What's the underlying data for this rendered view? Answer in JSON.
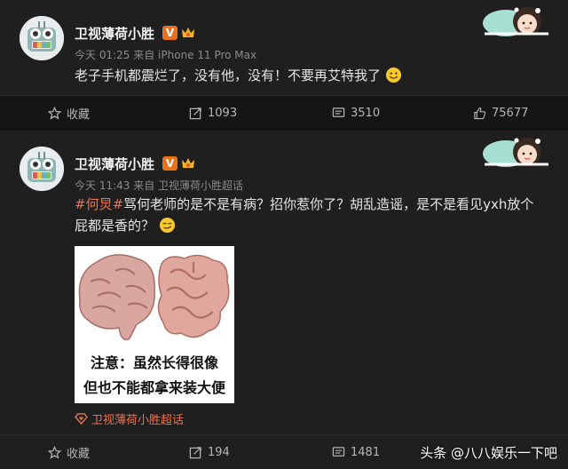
{
  "posts": [
    {
      "username": "卫视薄荷小胜",
      "verified_mark": "V",
      "time": "今天 01:25",
      "source": "来自 iPhone 11 Pro Max",
      "text": "老子手机都震烂了，没有他，没有！不要再艾特我了",
      "actions": {
        "favorite": "收藏",
        "repost": "1093",
        "comment": "3510",
        "like": "75677"
      }
    },
    {
      "username": "卫视薄荷小胜",
      "verified_mark": "V",
      "time": "今天 11:43",
      "source": "来自 卫视薄荷小胜超话",
      "topic": "#何炅#",
      "text": "骂何老师的是不是有病？招你惹你了？胡乱造谣，是不是看见yxh放个屁都是香的？",
      "meme_caption": [
        "注意：虽然长得很像",
        "但也不能都拿来装大便"
      ],
      "super_topic": "卫视薄荷小胜超话",
      "actions": {
        "favorite": "收藏",
        "repost": "194",
        "comment": "1481"
      }
    }
  ],
  "watermark": "头条 @八八娱乐一下吧",
  "colors": {
    "accent": "#eb7350",
    "verified": "#e8721c",
    "background": "#1f1f1f"
  }
}
